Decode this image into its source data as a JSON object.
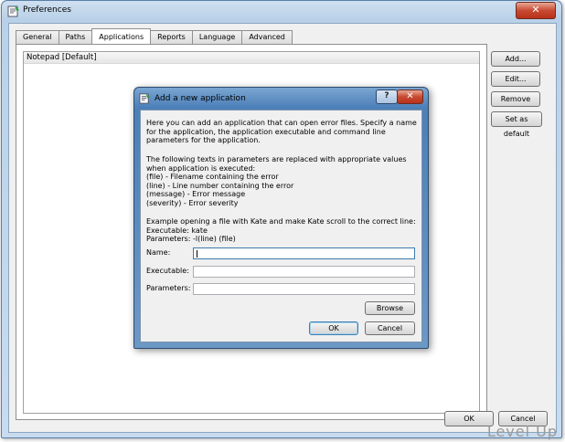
{
  "window": {
    "title": "Preferences",
    "close_glyph": "✕",
    "icon": "app-icon"
  },
  "tabs": [
    {
      "label": "General",
      "active": false
    },
    {
      "label": "Paths",
      "active": false
    },
    {
      "label": "Applications",
      "active": true
    },
    {
      "label": "Reports",
      "active": false
    },
    {
      "label": "Language",
      "active": false
    },
    {
      "label": "Advanced",
      "active": false
    }
  ],
  "applications": {
    "items": [
      "Notepad [Default]"
    ]
  },
  "side_buttons": {
    "add": "Add...",
    "edit": "Edit...",
    "remove": "Remove",
    "set_default": "Set as default"
  },
  "footer": {
    "ok": "OK",
    "cancel": "Cancel"
  },
  "dialog": {
    "title": "Add a new application",
    "help_glyph": "?",
    "close_glyph": "✕",
    "intro": "Here you can add an application that can open error files. Specify a name for the application, the application executable and command line parameters for the application.",
    "params_intro": "The following texts in parameters are replaced with appropriate values when application is executed:",
    "params_list": "(file) - Filename containing the error\n(line) - Line number containing the error\n(message) - Error message\n(severity) - Error severity",
    "example": "Example opening a file with Kate and make Kate scroll to the correct line:\nExecutable: kate\nParameters: -l(line) (file)",
    "fields": {
      "name_label": "Name:",
      "name_value": "",
      "executable_label": "Executable:",
      "executable_value": "",
      "parameters_label": "Parameters:",
      "parameters_value": ""
    },
    "browse": "Browse",
    "ok": "OK",
    "cancel": "Cancel"
  },
  "watermark": "Level Up"
}
